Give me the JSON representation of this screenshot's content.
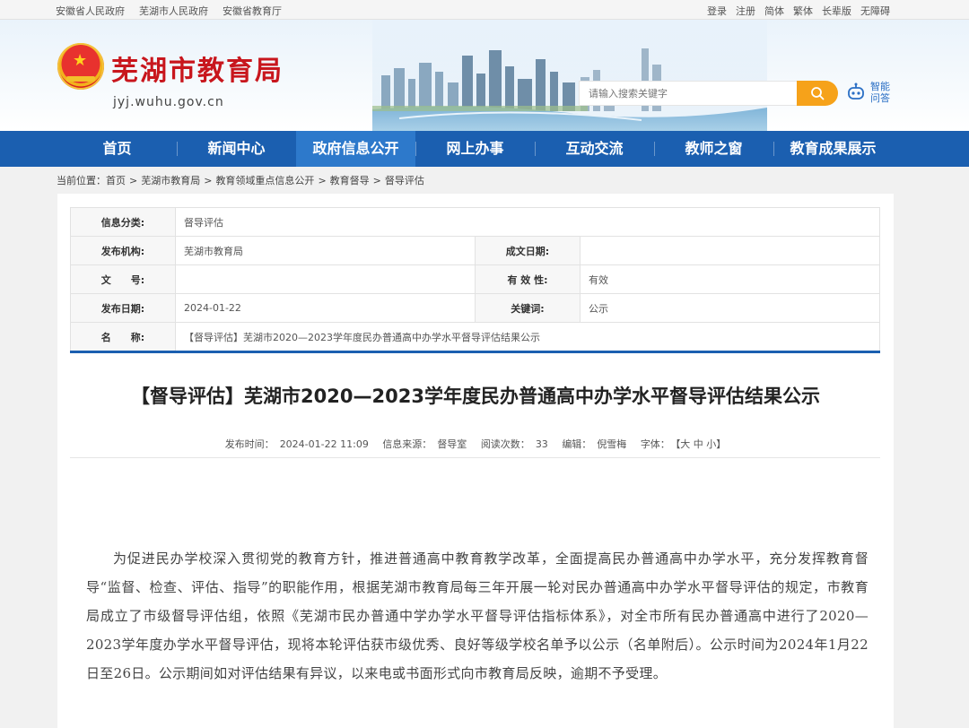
{
  "topbar": {
    "left_links": [
      "安徽省人民政府",
      "芜湖市人民政府",
      "安徽省教育厅"
    ],
    "right_links": [
      "登录",
      "注册",
      "简体",
      "繁体",
      "长辈版",
      "无障碍"
    ]
  },
  "header": {
    "site_title": "芜湖市教育局",
    "site_domain": "jyj.wuhu.gov.cn",
    "search_placeholder": "请输入搜索关键字",
    "ai_label": "智能问答"
  },
  "nav": {
    "items": [
      "首页",
      "新闻中心",
      "政府信息公开",
      "网上办事",
      "互动交流",
      "教师之窗",
      "教育成果展示"
    ],
    "active_index": 2
  },
  "breadcrumb": {
    "prefix": "当前位置：",
    "items": [
      "首页",
      "芜湖市教育局",
      "教育领域重点信息公开",
      "教育督导",
      "督导评估"
    ],
    "separator": ">"
  },
  "info_table": {
    "category_label": "信息分类:",
    "category_value": "督导评估",
    "publisher_label": "发布机构:",
    "publisher_value": "芜湖市教育局",
    "created_label": "成文日期:",
    "created_value": "",
    "docno_label": "文　　号:",
    "docno_value": "",
    "validity_label": "有 效 性:",
    "validity_value": "有效",
    "pubdate_label": "发布日期:",
    "pubdate_value": "2024-01-22",
    "keywords_label": "关键词:",
    "keywords_value": "公示",
    "name_label": "名　　称:",
    "name_value": "【督导评估】芜湖市2020—2023学年度民办普通高中办学水平督导评估结果公示"
  },
  "article": {
    "title": "【督导评估】芜湖市2020—2023学年度民办普通高中办学水平督导评估结果公示",
    "meta": {
      "time_label": "发布时间：",
      "time_value": "2024-01-22 11:09",
      "source_label": "信息来源：",
      "source_value": "督导室",
      "reads_label": "阅读次数：",
      "reads_value": "33",
      "editor_label": "编辑：",
      "editor_value": "倪雪梅",
      "font_label": "字体：",
      "font_sizes": "【大 中 小】"
    },
    "paragraph": "为促进民办学校深入贯彻党的教育方针，推进普通高中教育教学改革，全面提高民办普通高中办学水平，充分发挥教育督导“监督、检查、评估、指导”的职能作用，根据芜湖市教育局每三年开展一轮对民办普通高中办学水平督导评估的规定，市教育局成立了市级督导评估组，依照《芜湖市民办普通中学办学水平督导评估指标体系》，对全市所有民办普通高中进行了2020—2023学年度办学水平督导评估，现将本轮评估获市级优秀、良好等级学校名单予以公示（名单附后）。公示时间为2024年1月22日至26日。公示期间如对评估结果有异议，以来电或书面形式向市教育局反映，逾期不予受理。"
  },
  "colors": {
    "nav_bg": "#1b5fb0",
    "nav_active": "#2d79cb",
    "title_red": "#c8161d",
    "search_btn": "#f6a21a"
  }
}
